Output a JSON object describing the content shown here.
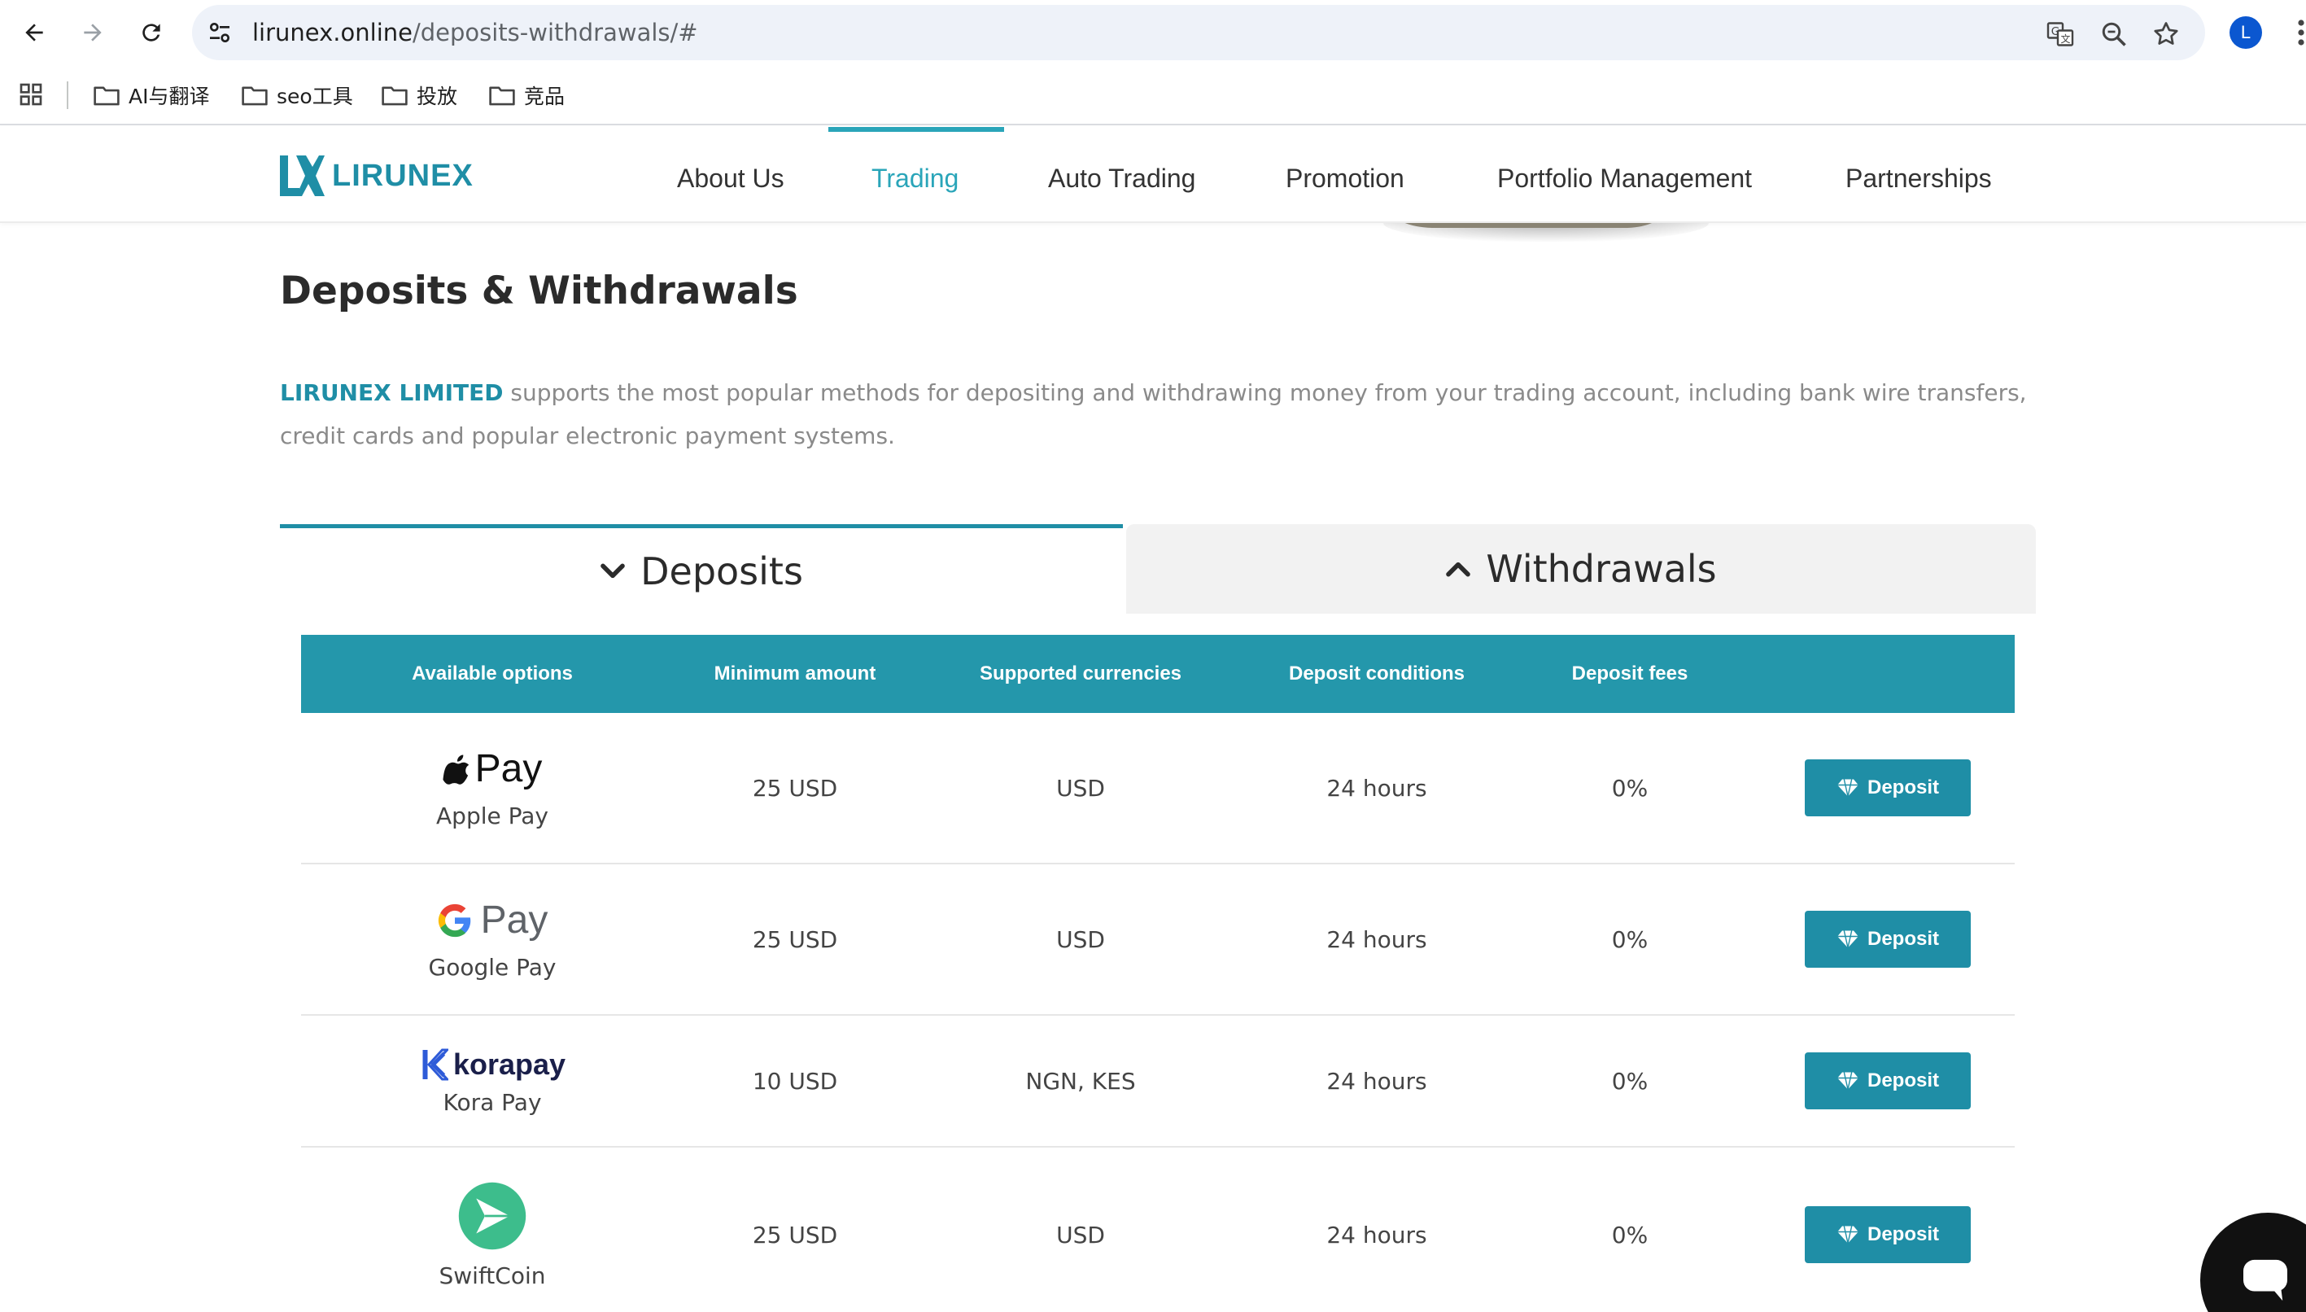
{
  "browser": {
    "url_host": "lirunex.online",
    "url_path": "/deposits-withdrawals/#",
    "profile_initial": "L",
    "bookmarks": [
      {
        "label": "AI与翻译"
      },
      {
        "label": "seo工具"
      },
      {
        "label": "投放"
      },
      {
        "label": "竞品"
      }
    ]
  },
  "site": {
    "logo_text": "LIRUNEX",
    "brand_color": "#1f8ea6",
    "accent_color": "#2aa5b9",
    "menu": [
      {
        "label": "About Us",
        "active": false
      },
      {
        "label": "Trading",
        "active": true
      },
      {
        "label": "Auto Trading",
        "active": false
      },
      {
        "label": "Promotion",
        "active": false
      },
      {
        "label": "Portfolio Management",
        "active": false
      },
      {
        "label": "Partnerships",
        "active": false
      }
    ]
  },
  "content": {
    "title": "Deposits & Withdrawals",
    "intro_brand": "LIRUNEX LIMITED",
    "intro_text": " supports the most popular methods for depositing and withdrawing money from your trading account, including bank wire transfers, credit cards and popular electronic payment systems.",
    "tabs": {
      "deposits": "Deposits",
      "withdrawals": "Withdrawals"
    },
    "table": {
      "headers": [
        "Available options",
        "Minimum amount",
        "Supported currencies",
        "Deposit conditions",
        "Deposit fees"
      ],
      "rows": [
        {
          "logo_icon": "apple-pay-logo",
          "logo_text": "Pay",
          "name": "Apple Pay",
          "min": "25 USD",
          "currencies": "USD",
          "conditions": "24 hours",
          "fees": "0%",
          "button": "Deposit"
        },
        {
          "logo_icon": "google-pay-logo",
          "logo_text": "Pay",
          "name": "Google Pay",
          "min": "25 USD",
          "currencies": "USD",
          "conditions": "24 hours",
          "fees": "0%",
          "button": "Deposit"
        },
        {
          "logo_icon": "korapay-logo",
          "logo_text": "korapay",
          "name": "Kora Pay",
          "min": "10 USD",
          "currencies": "NGN, KES",
          "conditions": "24 hours",
          "fees": "0%",
          "button": "Deposit"
        },
        {
          "logo_icon": "swiftcoin-logo",
          "name": "SwiftCoin",
          "min": "25 USD",
          "currencies": "USD",
          "conditions": "24 hours",
          "fees": "0%",
          "button": "Deposit"
        }
      ]
    }
  }
}
